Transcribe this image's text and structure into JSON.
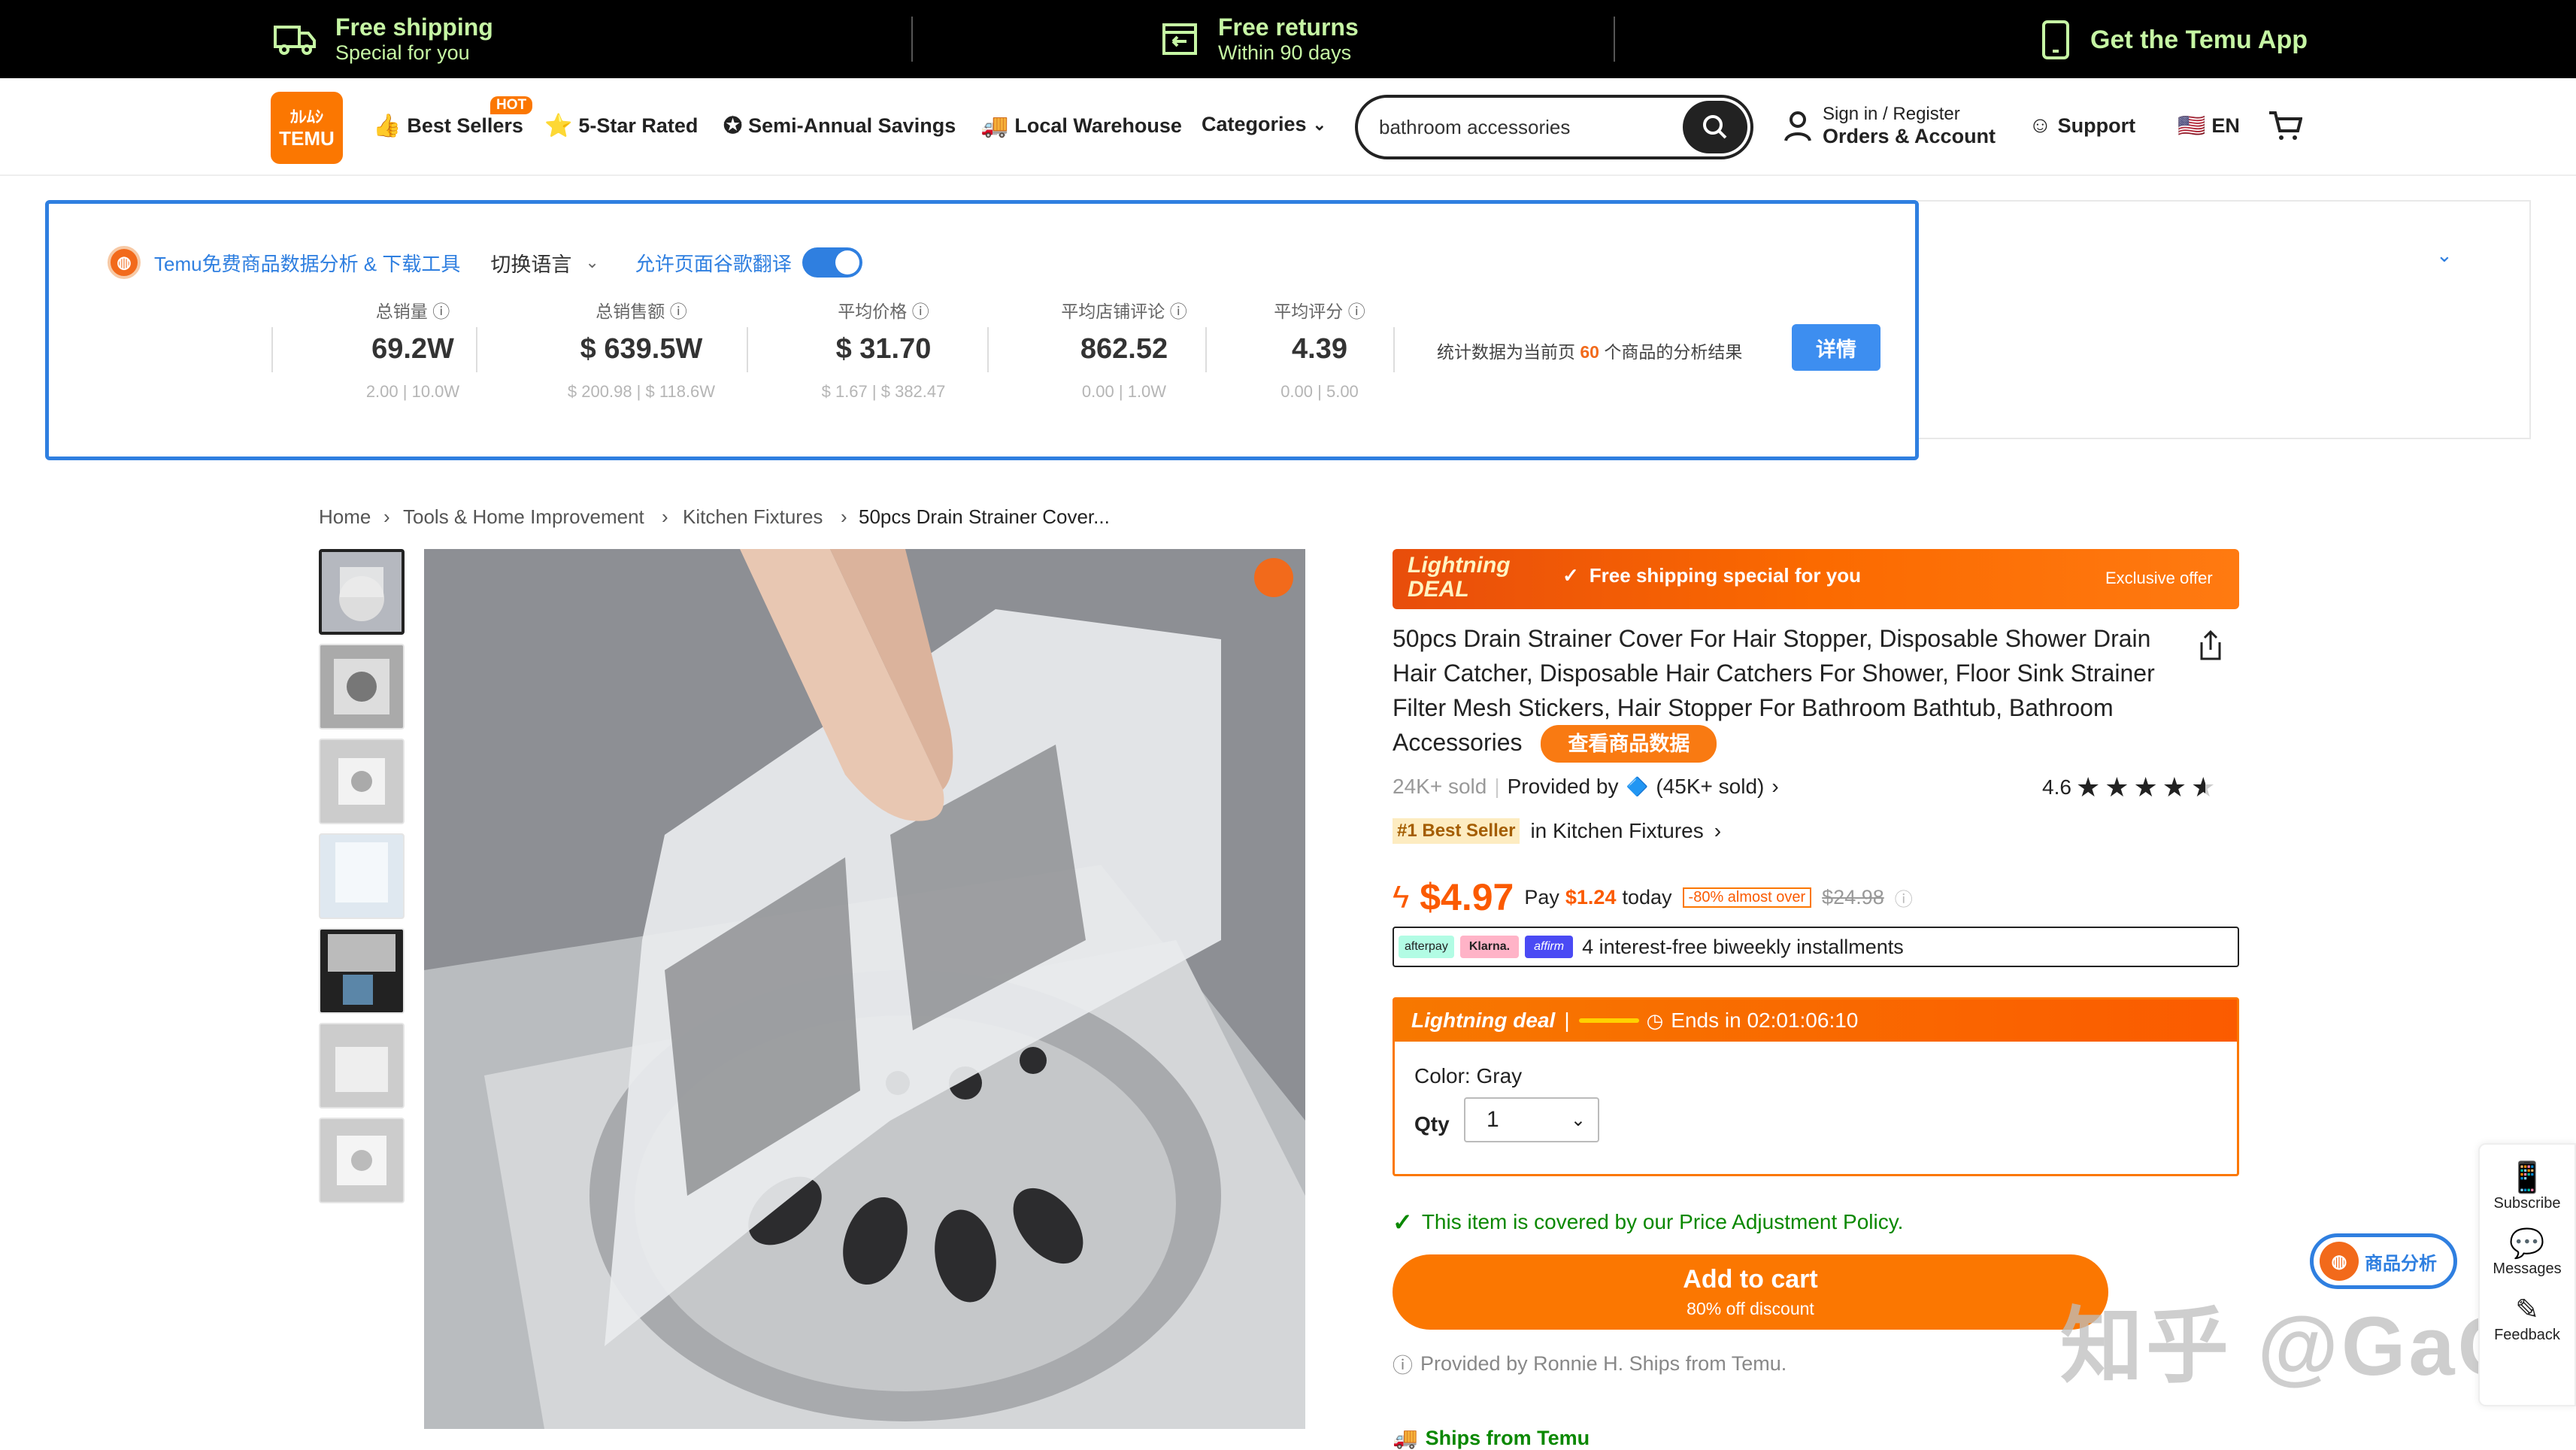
{
  "promo": {
    "shipping_title": "Free shipping",
    "shipping_sub": "Special for you",
    "returns_title": "Free returns",
    "returns_sub": "Within 90 days",
    "app": "Get the Temu App"
  },
  "header": {
    "logo_top": "ｶﾚﾑｼ",
    "logo": "TEMU",
    "nav": [
      "Best Sellers",
      "5-Star Rated",
      "Semi-Annual Savings",
      "Local Warehouse",
      "Categories"
    ],
    "hot_badge": "HOT",
    "search_value": "bathroom accessories",
    "signin_top": "Sign in / Register",
    "signin_bottom": "Orders & Account",
    "support": "Support",
    "lang": "EN"
  },
  "extension": {
    "brand": "Temu免费商品数据分析 & 下载工具",
    "lang_switch": "切换语言",
    "translate": "允许页面谷歌翻译",
    "translate_on": true,
    "stats": [
      {
        "label": "总销量",
        "value": "69.2W",
        "min": "2.00",
        "max": "10.0W"
      },
      {
        "label": "总销售额",
        "value": "$ 639.5W",
        "min": "$ 200.98",
        "max": "$ 118.6W"
      },
      {
        "label": "平均价格",
        "value": "$ 31.70",
        "min": "$ 1.67",
        "max": "$ 382.47"
      },
      {
        "label": "平均店铺评论",
        "value": "862.52",
        "min": "0.00",
        "max": "1.0W"
      },
      {
        "label": "平均评分",
        "value": "4.39",
        "min": "0.00",
        "max": "5.00"
      }
    ],
    "summary_pre": "统计数据为当前页",
    "summary_count": "60",
    "summary_post": "个商品的分析结果",
    "detail_btn": "详情"
  },
  "breadcrumb": [
    "Home",
    "Tools & Home Improvement",
    "Kitchen Fixtures",
    "50pcs Drain Strainer Cover..."
  ],
  "product": {
    "deal_logo": "Lightning DEAL",
    "deal_text": "Free shipping special for you",
    "deal_exclusive": "Exclusive offer",
    "title": "50pcs Drain Strainer Cover For Hair Stopper, Disposable Shower Drain Hair Catcher, Disposable Hair Catchers For Shower, Floor Sink Strainer Filter Mesh Stickers, Hair Stopper For Bathroom Bathtub, Bathroom Accessories",
    "view_data_btn": "查看商品数据",
    "sold": "24K+ sold",
    "provided_by": "Provided by",
    "seller_sold": "(45K+ sold)",
    "rating": "4.6",
    "stars": 4.6,
    "best_seller_badge": "#1 Best Seller",
    "best_seller_cat": "in Kitchen Fixtures",
    "price": "$4.97",
    "pay_label": "Pay",
    "pay_amount": "$1.24",
    "pay_suffix": "today",
    "discount_badge": "-80% almost over",
    "orig_price": "$24.98",
    "pay_logos": [
      "afterpay",
      "Klarna.",
      "affirm"
    ],
    "installments": "4 interest-free biweekly installments",
    "lightning_label": "Lightning deal",
    "ends_label": "Ends in 02:01:06:10",
    "color_label": "Color: Gray",
    "qty_label": "Qty",
    "qty_value": "1",
    "price_policy": "This item is covered by our Price Adjustment Policy.",
    "add_to_cart": "Add to cart",
    "add_to_cart_sub": "80% off discount",
    "provided_note": "Provided by Ronnie H. Ships from Temu.",
    "ships_from": "Ships from Temu"
  },
  "side": {
    "subscribe": "Subscribe",
    "messages": "Messages",
    "feedback": "Feedback",
    "analysis": "商品分析"
  },
  "watermark": "知乎 @GaGa",
  "colors": {
    "temu_orange": "#fb7701",
    "ext_blue": "#2f7fe0",
    "promo_green": "#c6f6a4"
  }
}
